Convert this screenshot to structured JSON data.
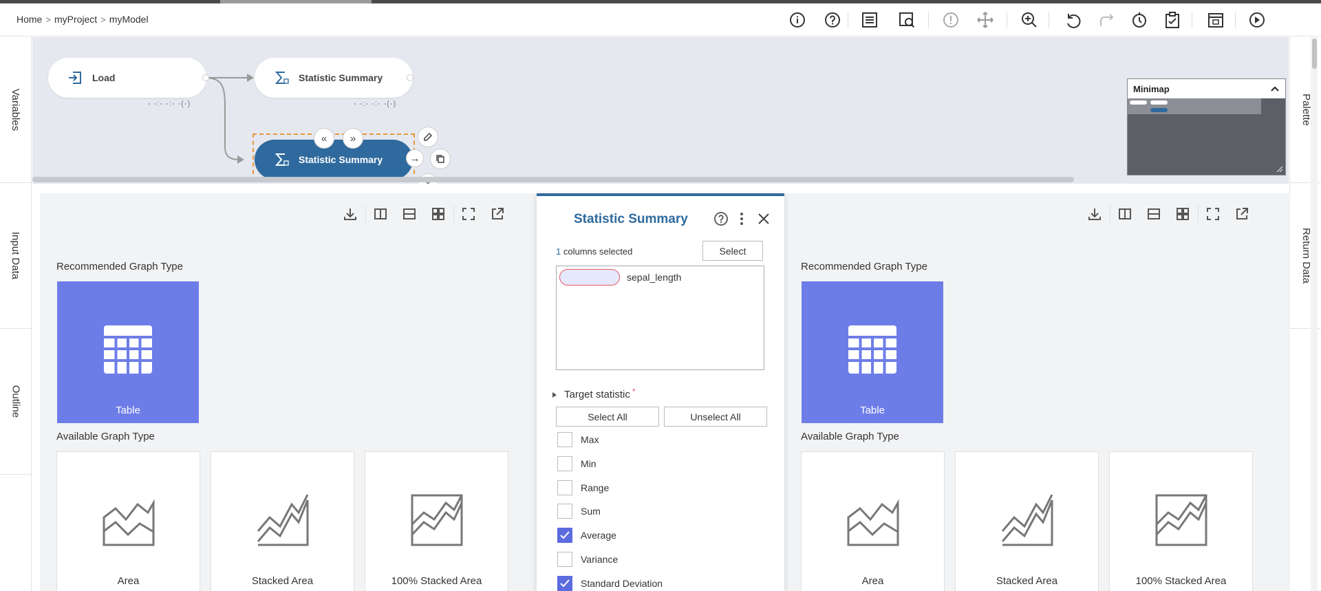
{
  "breadcrumb": [
    "Home",
    "myProject",
    "myModel"
  ],
  "side_left_tabs": [
    "Variables",
    "Input Data",
    "Outline"
  ],
  "side_right_tabs": [
    "Palette",
    "Return Data"
  ],
  "canvas": {
    "nodes": [
      {
        "label": "Load",
        "icon": "load-icon",
        "meta": "- -:- -:- -(-)"
      },
      {
        "label": "Statistic Summary",
        "icon": "sigma-icon",
        "meta": "- -:- -:- -(-)"
      },
      {
        "label": "Statistic Summary",
        "icon": "sigma-icon",
        "selected": true
      }
    ],
    "minimap": {
      "title": "Minimap"
    }
  },
  "left_panel": {
    "recommended_title": "Recommended Graph Type",
    "recommended": {
      "label": "Table",
      "icon": "table-icon"
    },
    "available_title": "Available Graph Type",
    "available": [
      {
        "label": "Area",
        "icon": "area-chart-icon"
      },
      {
        "label": "Stacked Area",
        "icon": "stacked-area-chart-icon"
      },
      {
        "label": "100% Stacked Area",
        "icon": "percent-stacked-area-chart-icon"
      }
    ]
  },
  "right_panel": {
    "recommended_title": "Recommended Graph Type",
    "recommended": {
      "label": "Table",
      "icon": "table-icon"
    },
    "available_title": "Available Graph Type",
    "available": [
      {
        "label": "Area",
        "icon": "area-chart-icon"
      },
      {
        "label": "Stacked Area",
        "icon": "stacked-area-chart-icon"
      },
      {
        "label": "100% Stacked Area",
        "icon": "percent-stacked-area-chart-icon"
      }
    ]
  },
  "dialog": {
    "title": "Statistic Summary",
    "columns_count": "1",
    "columns_text": "columns selected",
    "select_button": "Select",
    "selected_column": "sepal_length",
    "target_label": "Target statistic",
    "required_mark": "*",
    "select_all": "Select All",
    "unselect_all": "Unselect All",
    "statistics": [
      {
        "label": "Max",
        "checked": false
      },
      {
        "label": "Min",
        "checked": false
      },
      {
        "label": "Range",
        "checked": false
      },
      {
        "label": "Sum",
        "checked": false
      },
      {
        "label": "Average",
        "checked": true
      },
      {
        "label": "Variance",
        "checked": false
      },
      {
        "label": "Standard Deviation",
        "checked": true
      }
    ]
  },
  "colors": {
    "accent": "#2f6a9e",
    "graph_tile": "#6d7de8",
    "checkbox": "#5c6bdf",
    "canvas": "#e5e8ef"
  }
}
